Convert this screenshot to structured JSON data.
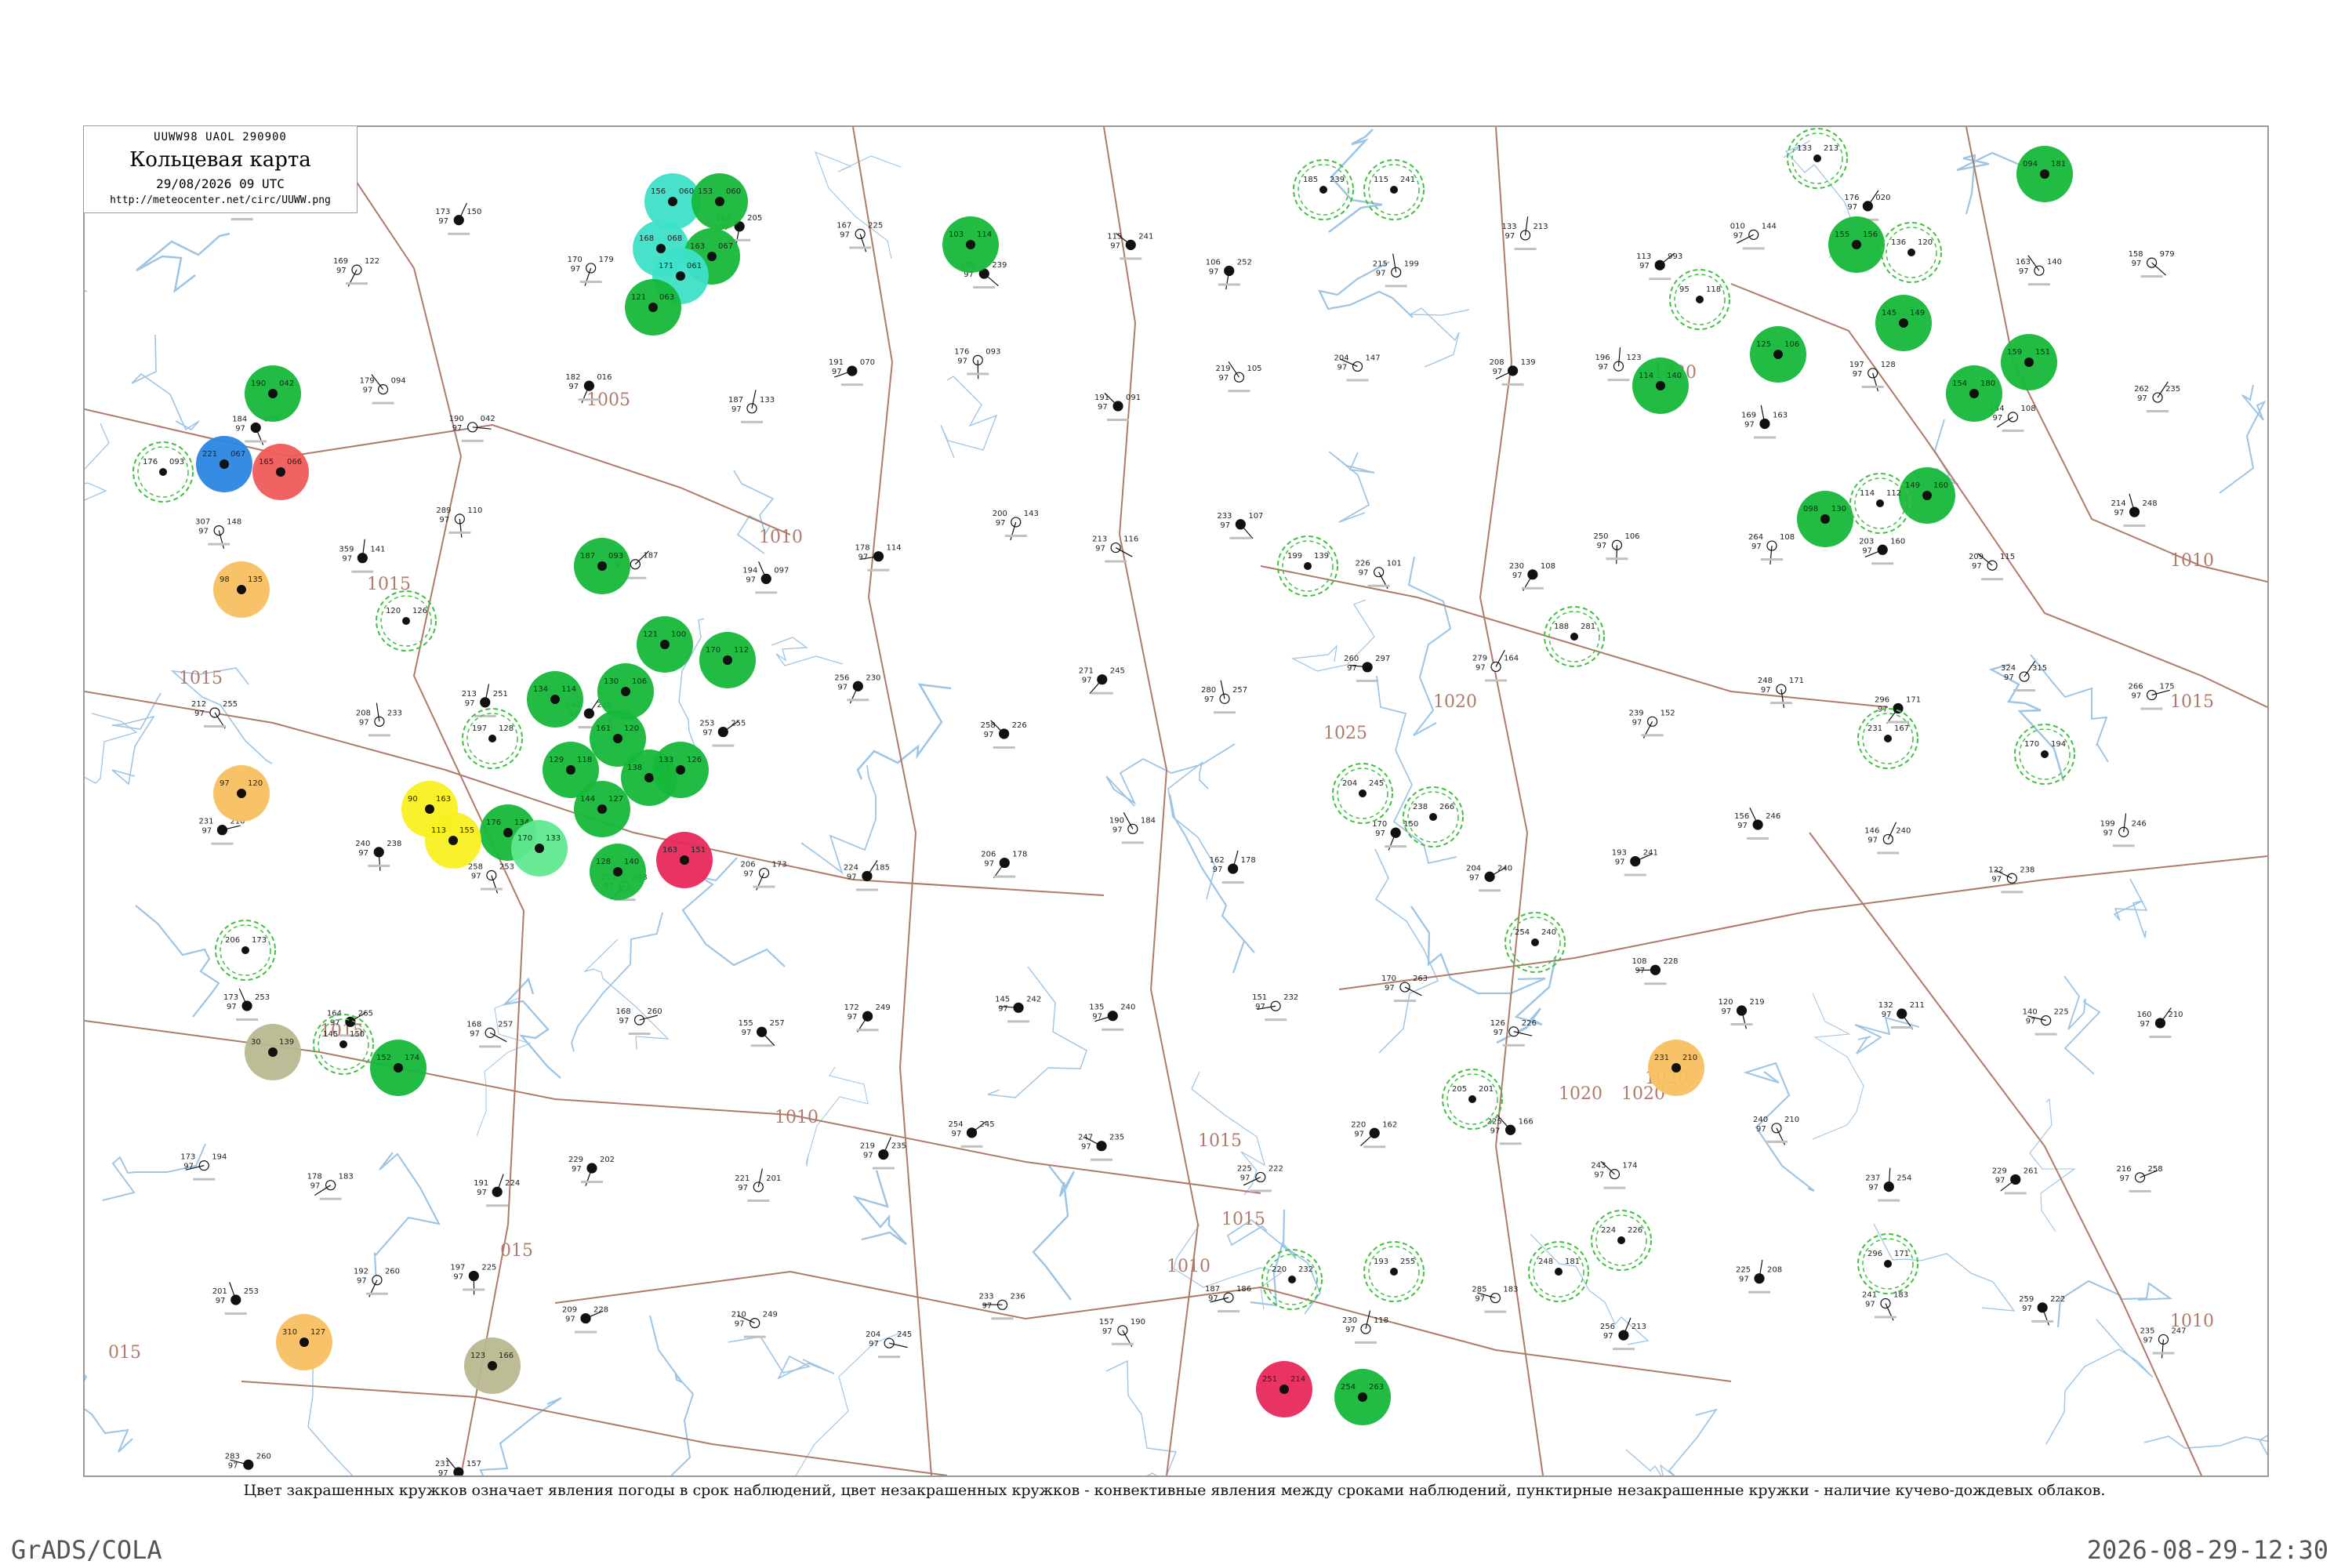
{
  "header": {
    "code": "UUWW98  UAOL  290900",
    "title": "Кольцевая карта",
    "time": "29/08/2026 09 UTC",
    "url": "http://meteocenter.net/circ/UUWW.png"
  },
  "caption": "Цвет закрашенных кружков означает явления погоды в срок наблюдений, цвет незакрашенных кружков - конвективные явления между сроками наблюдений, пунктирные незакрашенные кружки - наличие кучево-дождевых облаков.",
  "footer": {
    "left": "GrADS/COLA",
    "right": "2026-08-29-12:30"
  },
  "colors": {
    "frame": "#9a9a9a",
    "isobar": "#b07a6a",
    "river": "#9cc4e4",
    "rain_green": "#16b83a",
    "cyan": "#3ee0c8",
    "blue": "#2a86e0",
    "red": "#f05a5a",
    "crimson": "#e8285a",
    "orange": "#f8c060",
    "yellow": "#f8f020",
    "olive": "#b8b890",
    "light_green": "#60e890",
    "dashed_ring": "#40c040",
    "station": "#111111"
  },
  "isobars": [
    {
      "label": "1005"
    },
    {
      "label": "1010"
    },
    {
      "label": "1015"
    },
    {
      "label": "1015"
    },
    {
      "label": "1010"
    },
    {
      "label": "1015"
    },
    {
      "label": "1020"
    },
    {
      "label": "1020"
    },
    {
      "label": "1025"
    },
    {
      "label": "1010"
    },
    {
      "label": "1015"
    },
    {
      "label": "1020"
    },
    {
      "label": "1020"
    },
    {
      "label": "1010"
    },
    {
      "label": "1015"
    },
    {
      "label": "1010"
    },
    {
      "label": "015"
    },
    {
      "label": "015"
    },
    {
      "label": "1015"
    },
    {
      "label": "1020"
    }
  ],
  "stations": [
    {
      "t": "153",
      "p": "072",
      "d": "97"
    },
    {
      "t": "169",
      "p": "122",
      "d": "97"
    },
    {
      "t": "173",
      "p": "150",
      "d": "97"
    },
    {
      "t": "170",
      "p": "179",
      "d": "97"
    },
    {
      "t": "162",
      "p": "205",
      "d": "97"
    },
    {
      "t": "167",
      "p": "225",
      "d": "97"
    },
    {
      "t": "185",
      "p": "239",
      "d": "97"
    },
    {
      "t": "115",
      "p": "241",
      "d": "97"
    },
    {
      "t": "106",
      "p": "252",
      "d": "97"
    },
    {
      "t": "215",
      "p": "199",
      "d": "97"
    },
    {
      "t": "133",
      "p": "213",
      "d": "97"
    },
    {
      "t": "113",
      "p": "993",
      "d": "97"
    },
    {
      "t": "010",
      "p": "144",
      "d": "97"
    },
    {
      "t": "176",
      "p": "020",
      "d": "97"
    },
    {
      "t": "163",
      "p": "140",
      "d": "97"
    },
    {
      "t": "158",
      "p": "979",
      "d": "97"
    },
    {
      "t": "184",
      "p": "029",
      "d": "97"
    },
    {
      "t": "179",
      "p": "094",
      "d": "97"
    },
    {
      "t": "190",
      "p": "042",
      "d": "97"
    },
    {
      "t": "182",
      "p": "016",
      "d": "97"
    },
    {
      "t": "187",
      "p": "133",
      "d": "97"
    },
    {
      "t": "191",
      "p": "070",
      "d": "97"
    },
    {
      "t": "176",
      "p": "093",
      "d": "97"
    },
    {
      "t": "191",
      "p": "091",
      "d": "97"
    },
    {
      "t": "219",
      "p": "105",
      "d": "97"
    },
    {
      "t": "204",
      "p": "147",
      "d": "97"
    },
    {
      "t": "208",
      "p": "139",
      "d": "97"
    },
    {
      "t": "196",
      "p": "123",
      "d": "97"
    },
    {
      "t": "169",
      "p": "163",
      "d": "97"
    },
    {
      "t": "197",
      "p": "128",
      "d": "97"
    },
    {
      "t": "154",
      "p": "108",
      "d": "97"
    },
    {
      "t": "262",
      "p": "235",
      "d": "97"
    },
    {
      "t": "307",
      "p": "148",
      "d": "97"
    },
    {
      "t": "359",
      "p": "141",
      "d": "97"
    },
    {
      "t": "289",
      "p": "110",
      "d": "97"
    },
    {
      "t": "329",
      "p": "187",
      "d": "97"
    },
    {
      "t": "194",
      "p": "097",
      "d": "97"
    },
    {
      "t": "178",
      "p": "114",
      "d": "97"
    },
    {
      "t": "200",
      "p": "143",
      "d": "97"
    },
    {
      "t": "213",
      "p": "116",
      "d": "97"
    },
    {
      "t": "233",
      "p": "107",
      "d": "97"
    },
    {
      "t": "226",
      "p": "101",
      "d": "97"
    },
    {
      "t": "230",
      "p": "108",
      "d": "97"
    },
    {
      "t": "250",
      "p": "106",
      "d": "97"
    },
    {
      "t": "264",
      "p": "108",
      "d": "97"
    },
    {
      "t": "203",
      "p": "160",
      "d": "97"
    },
    {
      "t": "209",
      "p": "115",
      "d": "97"
    },
    {
      "t": "214",
      "p": "248",
      "d": "97"
    },
    {
      "t": "212",
      "p": "255",
      "d": "97"
    },
    {
      "t": "208",
      "p": "233",
      "d": "97"
    },
    {
      "t": "213",
      "p": "251",
      "d": "97"
    },
    {
      "t": "242",
      "p": "218",
      "d": "97"
    },
    {
      "t": "253",
      "p": "255",
      "d": "97"
    },
    {
      "t": "256",
      "p": "230",
      "d": "97"
    },
    {
      "t": "258",
      "p": "226",
      "d": "97"
    },
    {
      "t": "271",
      "p": "245",
      "d": "97"
    },
    {
      "t": "280",
      "p": "257",
      "d": "97"
    },
    {
      "t": "260",
      "p": "297",
      "d": "97"
    },
    {
      "t": "279",
      "p": "164",
      "d": "97"
    },
    {
      "t": "239",
      "p": "152",
      "d": "97"
    },
    {
      "t": "248",
      "p": "171",
      "d": "97"
    },
    {
      "t": "296",
      "p": "171",
      "d": "97"
    },
    {
      "t": "324",
      "p": "315",
      "d": "97"
    },
    {
      "t": "266",
      "p": "175",
      "d": "97"
    },
    {
      "t": "231",
      "p": "210",
      "d": "97"
    },
    {
      "t": "240",
      "p": "238",
      "d": "97"
    },
    {
      "t": "258",
      "p": "253",
      "d": "97"
    },
    {
      "t": "212",
      "p": "248",
      "d": "97"
    },
    {
      "t": "206",
      "p": "173",
      "d": "97"
    },
    {
      "t": "224",
      "p": "185",
      "d": "97"
    },
    {
      "t": "206",
      "p": "178",
      "d": "97"
    },
    {
      "t": "190",
      "p": "184",
      "d": "97"
    },
    {
      "t": "162",
      "p": "178",
      "d": "97"
    },
    {
      "t": "170",
      "p": "150",
      "d": "97"
    },
    {
      "t": "204",
      "p": "240",
      "d": "97"
    },
    {
      "t": "193",
      "p": "241",
      "d": "97"
    },
    {
      "t": "156",
      "p": "246",
      "d": "97"
    },
    {
      "t": "146",
      "p": "240",
      "d": "97"
    },
    {
      "t": "122",
      "p": "238",
      "d": "97"
    },
    {
      "t": "199",
      "p": "246",
      "d": "97"
    },
    {
      "t": "173",
      "p": "253",
      "d": "97"
    },
    {
      "t": "164",
      "p": "265",
      "d": "97"
    },
    {
      "t": "168",
      "p": "257",
      "d": "97"
    },
    {
      "t": "168",
      "p": "260",
      "d": "97"
    },
    {
      "t": "155",
      "p": "257",
      "d": "97"
    },
    {
      "t": "172",
      "p": "249",
      "d": "97"
    },
    {
      "t": "145",
      "p": "242",
      "d": "97"
    },
    {
      "t": "135",
      "p": "240",
      "d": "97"
    },
    {
      "t": "151",
      "p": "232",
      "d": "97"
    },
    {
      "t": "170",
      "p": "263",
      "d": "97"
    },
    {
      "t": "126",
      "p": "226",
      "d": "97"
    },
    {
      "t": "108",
      "p": "228",
      "d": "97"
    },
    {
      "t": "120",
      "p": "219",
      "d": "97"
    },
    {
      "t": "132",
      "p": "211",
      "d": "97"
    },
    {
      "t": "140",
      "p": "225",
      "d": "97"
    },
    {
      "t": "160",
      "p": "210",
      "d": "97"
    },
    {
      "t": "173",
      "p": "194",
      "d": "97"
    },
    {
      "t": "178",
      "p": "183",
      "d": "97"
    },
    {
      "t": "191",
      "p": "224",
      "d": "97"
    },
    {
      "t": "229",
      "p": "202",
      "d": "97"
    },
    {
      "t": "221",
      "p": "201",
      "d": "97"
    },
    {
      "t": "219",
      "p": "235",
      "d": "97"
    },
    {
      "t": "254",
      "p": "245",
      "d": "97"
    },
    {
      "t": "247",
      "p": "235",
      "d": "97"
    },
    {
      "t": "225",
      "p": "222",
      "d": "97"
    },
    {
      "t": "220",
      "p": "162",
      "d": "97"
    },
    {
      "t": "225",
      "p": "166",
      "d": "97"
    },
    {
      "t": "243",
      "p": "174",
      "d": "97"
    },
    {
      "t": "240",
      "p": "210",
      "d": "97"
    },
    {
      "t": "237",
      "p": "254",
      "d": "97"
    },
    {
      "t": "229",
      "p": "261",
      "d": "97"
    },
    {
      "t": "216",
      "p": "258",
      "d": "97"
    },
    {
      "t": "201",
      "p": "253",
      "d": "97"
    },
    {
      "t": "192",
      "p": "260",
      "d": "97"
    },
    {
      "t": "197",
      "p": "225",
      "d": "97"
    },
    {
      "t": "209",
      "p": "228",
      "d": "97"
    },
    {
      "t": "210",
      "p": "249",
      "d": "97"
    },
    {
      "t": "204",
      "p": "245",
      "d": "97"
    },
    {
      "t": "233",
      "p": "236",
      "d": "97"
    },
    {
      "t": "157",
      "p": "190",
      "d": "97"
    },
    {
      "t": "187",
      "p": "186",
      "d": "97"
    },
    {
      "t": "230",
      "p": "118",
      "d": "97"
    },
    {
      "t": "285",
      "p": "183",
      "d": "97"
    },
    {
      "t": "256",
      "p": "213",
      "d": "97"
    },
    {
      "t": "225",
      "p": "208",
      "d": "97"
    },
    {
      "t": "241",
      "p": "183",
      "d": "97"
    },
    {
      "t": "259",
      "p": "222",
      "d": "97"
    },
    {
      "t": "235",
      "p": "247",
      "d": "97"
    },
    {
      "t": "283",
      "p": "260",
      "d": "97"
    },
    {
      "t": "248",
      "p": "191",
      "d": "97"
    },
    {
      "t": "231",
      "p": "157",
      "d": "97"
    }
  ],
  "circles": [
    {
      "kind": "cyan",
      "t": "156",
      "p": "060"
    },
    {
      "kind": "green",
      "t": "153",
      "p": "060"
    },
    {
      "kind": "cyan",
      "t": "168",
      "p": "068"
    },
    {
      "kind": "green",
      "t": "163",
      "p": "067"
    },
    {
      "kind": "cyan",
      "t": "171",
      "p": "061"
    },
    {
      "kind": "green",
      "t": "121",
      "p": "063"
    },
    {
      "kind": "green",
      "t": "190",
      "p": "042"
    },
    {
      "kind": "blue",
      "t": "221",
      "p": "067"
    },
    {
      "kind": "red",
      "t": "165",
      "p": "066"
    },
    {
      "kind": "green",
      "t": "187",
      "p": "093"
    },
    {
      "kind": "green",
      "t": "121",
      "p": "100"
    },
    {
      "kind": "green",
      "t": "130",
      "p": "106"
    },
    {
      "kind": "green",
      "t": "170",
      "p": "112"
    },
    {
      "kind": "green",
      "t": "134",
      "p": "114"
    },
    {
      "kind": "green",
      "t": "161",
      "p": "120"
    },
    {
      "kind": "green",
      "t": "129",
      "p": "118"
    },
    {
      "kind": "green",
      "t": "138",
      "p": "121"
    },
    {
      "kind": "green",
      "t": "144",
      "p": "127"
    },
    {
      "kind": "green",
      "t": "133",
      "p": "126"
    },
    {
      "kind": "green",
      "t": "176",
      "p": "134"
    },
    {
      "kind": "green",
      "t": "128",
      "p": "140"
    },
    {
      "kind": "light_green",
      "t": "170",
      "p": "133"
    },
    {
      "kind": "crimson",
      "t": "163",
      "p": "151"
    },
    {
      "kind": "yellow",
      "t": "90",
      "p": "163"
    },
    {
      "kind": "yellow",
      "t": "113",
      "p": "155"
    },
    {
      "kind": "orange",
      "t": "98",
      "p": "135"
    },
    {
      "kind": "orange",
      "t": "97",
      "p": "120"
    },
    {
      "kind": "olive",
      "t": "30",
      "p": "139"
    },
    {
      "kind": "green",
      "t": "152",
      "p": "174"
    },
    {
      "kind": "orange",
      "t": "310",
      "p": "127"
    },
    {
      "kind": "olive",
      "t": "123",
      "p": "166"
    },
    {
      "kind": "crimson",
      "t": "251",
      "p": "214"
    },
    {
      "kind": "green",
      "t": "254",
      "p": "263"
    },
    {
      "kind": "orange",
      "t": "231",
      "p": "210"
    },
    {
      "kind": "green",
      "t": "094",
      "p": "181"
    },
    {
      "kind": "green",
      "t": "103",
      "p": "114"
    },
    {
      "kind": "green",
      "t": "155",
      "p": "156"
    },
    {
      "kind": "green",
      "t": "145",
      "p": "149"
    },
    {
      "kind": "green",
      "t": "125",
      "p": "106"
    },
    {
      "kind": "green",
      "t": "114",
      "p": "140"
    },
    {
      "kind": "green",
      "t": "159",
      "p": "151"
    },
    {
      "kind": "green",
      "t": "154",
      "p": "180"
    },
    {
      "kind": "green",
      "t": "149",
      "p": "160"
    },
    {
      "kind": "green",
      "t": "098",
      "p": "130"
    }
  ],
  "rings": [
    {
      "t": "185",
      "p": "239"
    },
    {
      "t": "115",
      "p": "241"
    },
    {
      "t": "199",
      "p": "139"
    },
    {
      "t": "176",
      "p": "093"
    },
    {
      "t": "120",
      "p": "126"
    },
    {
      "t": "197",
      "p": "128"
    },
    {
      "t": "206",
      "p": "173"
    },
    {
      "t": "254",
      "p": "240"
    },
    {
      "t": "145",
      "p": "150"
    },
    {
      "t": "133",
      "p": "213"
    },
    {
      "t": "114",
      "p": "112"
    },
    {
      "t": "170",
      "p": "194"
    },
    {
      "t": "193",
      "p": "255"
    },
    {
      "t": "248",
      "p": "181"
    },
    {
      "t": "296",
      "p": "171"
    },
    {
      "t": "224",
      "p": "226"
    },
    {
      "t": "204",
      "p": "245"
    },
    {
      "t": "238",
      "p": "266"
    },
    {
      "t": "188",
      "p": "281"
    },
    {
      "t": "95",
      "p": "118"
    },
    {
      "t": "136",
      "p": "120"
    },
    {
      "t": "205",
      "p": "201"
    },
    {
      "t": "220",
      "p": "232"
    },
    {
      "t": "231",
      "p": "167"
    }
  ]
}
